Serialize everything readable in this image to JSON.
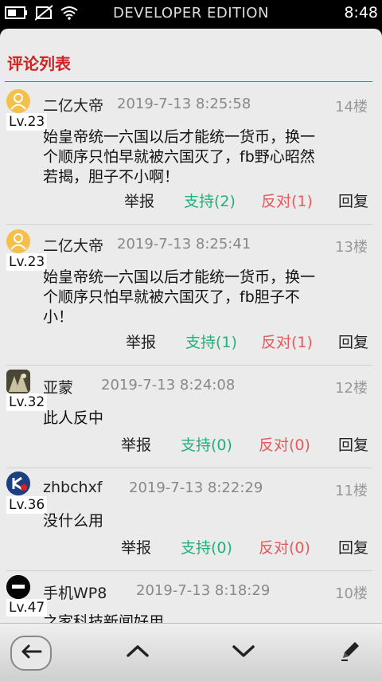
{
  "status_bar": {
    "edition": "DEVELOPER EDITION",
    "time": "8:48",
    "icons": [
      "battery-icon",
      "no-sim-icon",
      "wifi-icon"
    ]
  },
  "page": {
    "title": "评论列表"
  },
  "actions": {
    "report": "举报",
    "reply": "回复"
  },
  "comments": [
    {
      "user": "二亿大帝",
      "level": "Lv.23",
      "time": "2019-7-13 8:25:58",
      "floor": "14楼",
      "lines": [
        "始皇帝统一六国以后才能统一货币，换一",
        "个顺序只怕早就被六国灭了，fb野心昭然",
        "若揭，胆子不小啊！"
      ],
      "support": "支持(2)",
      "oppose": "反对(1)",
      "avatar": "default-user-avatar"
    },
    {
      "user": "二亿大帝",
      "level": "Lv.23",
      "time": "2019-7-13 8:25:41",
      "floor": "13楼",
      "lines": [
        "始皇帝统一六国以后才能统一货币，换一",
        "个顺序只怕早就被六国灭了，fb胆子不",
        "小！"
      ],
      "support": "支持(1)",
      "oppose": "反对(1)",
      "avatar": "default-user-avatar"
    },
    {
      "user": "亚蒙",
      "level": "Lv.32",
      "time": "2019-7-13 8:24:08",
      "floor": "12楼",
      "lines": [
        "此人反中"
      ],
      "support": "支持(0)",
      "oppose": "反对(0)",
      "avatar": "photo-avatar"
    },
    {
      "user": "zhbchxf",
      "level": "Lv.36",
      "time": "2019-7-13 8:22:29",
      "floor": "11楼",
      "lines": [
        "没什么用"
      ],
      "support": "支持(0)",
      "oppose": "反对(0)",
      "avatar": "logo-avatar"
    },
    {
      "user": "手机WP8",
      "level": "Lv.47",
      "time": "2019-7-13 8:18:29",
      "floor": "10楼",
      "lines": [
        "之家科技新闻好用"
      ],
      "avatar": "dark-avatar"
    }
  ],
  "toolbar": {
    "buttons": [
      "back-icon",
      "up-chevron-icon",
      "down-chevron-icon",
      "edit-icon"
    ]
  },
  "colors": {
    "accent": "#d32020",
    "support": "#22b07a",
    "oppose": "#e55a5a",
    "panel": "#ebebeb"
  }
}
